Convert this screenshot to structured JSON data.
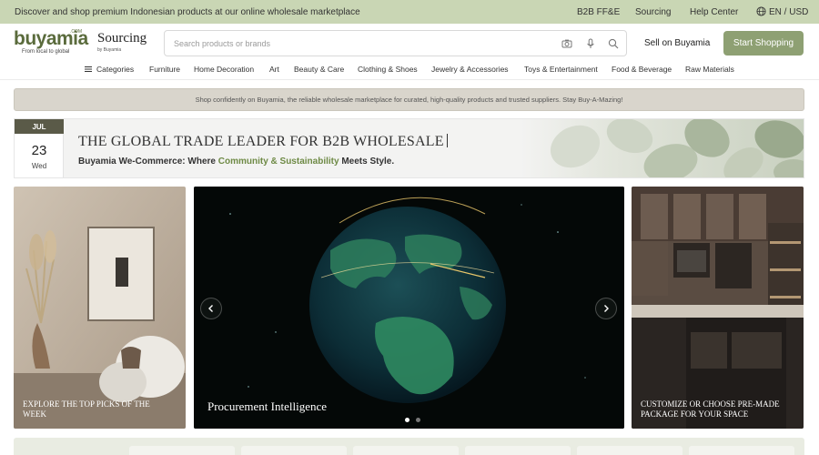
{
  "topbar": {
    "promo": "Discover and shop premium Indonesian products at our online wholesale marketplace",
    "links": [
      "B2B FF&E",
      "Sourcing",
      "Help Center",
      "EN / USD"
    ]
  },
  "header": {
    "logo_word": "buyamia",
    "logo_com": ".COM",
    "logo_tagline": "From local to global",
    "sourcing_title": "Sourcing",
    "sourcing_sub": "by Buyamia",
    "search_placeholder": "Search products or brands",
    "sell_label": "Sell on Buyamia",
    "start_label": "Start Shopping"
  },
  "nav": {
    "items": [
      "Categories",
      "Furniture",
      "Home Decoration",
      "Art",
      "Beauty & Care",
      "Clothing & Shoes",
      "Jewelry & Accessories",
      "Toys & Entertainment",
      "Food & Beverage",
      "Raw Materials"
    ]
  },
  "notice": "Shop confidently on Buyamia, the reliable wholesale marketplace for curated, high-quality products and trusted suppliers. Stay Buy-A-Mazing!",
  "hero": {
    "month": "JUL",
    "day": "23",
    "weekday": "Wed",
    "headline": "THE GLOBAL TRADE LEADER FOR B2B WHOLESALE",
    "sub_pre": "Buyamia We-Commerce: Where ",
    "sub_accent": "Community & Sustainability",
    "sub_post": " Meets Style."
  },
  "panels": {
    "left_caption": "EXPLORE THE TOP PICKS OF THE WEEK",
    "center_caption": "Procurement Intelligence",
    "right_caption": "CUSTOMIZE OR CHOOSE PRE-MADE PACKAGE FOR YOUR SPACE"
  },
  "carousel": {
    "slide_count": 2,
    "active_index": 0
  },
  "colors": {
    "brand": "#5a6b3c",
    "accent": "#8ea073",
    "topbar": "#c9d6b4"
  },
  "icons": [
    "globe-icon",
    "camera-icon",
    "microphone-icon",
    "search-icon",
    "menu-icon",
    "chevron-left-icon",
    "chevron-right-icon"
  ]
}
